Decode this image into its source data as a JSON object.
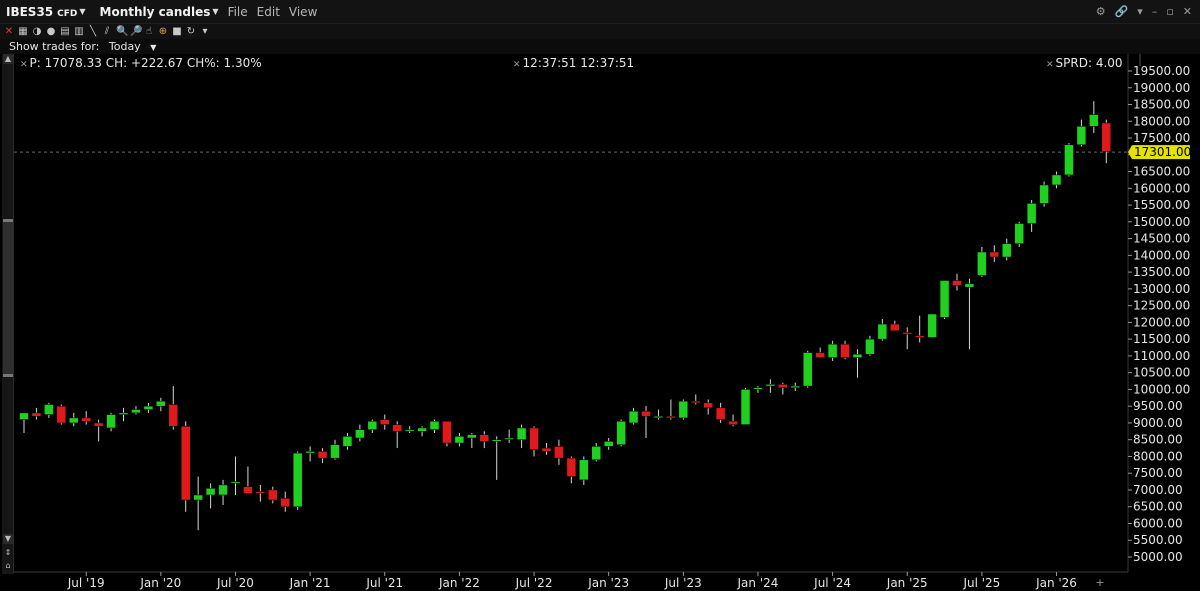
{
  "window": {
    "symbol": "IBES35",
    "symbol_type": "CFD",
    "period": "Monthly candles",
    "menus": [
      "File",
      "Edit",
      "View"
    ],
    "menu_keys": [
      "F",
      "E",
      "V"
    ],
    "show_trades_label": "Show trades for:",
    "show_trades_value": "Today",
    "icons": [
      "gear-icon",
      "link-icon",
      "minimize-icon",
      "restore-icon",
      "close-icon"
    ]
  },
  "info_bar": {
    "left": "P: 17078.33 CH: +222.67 CH%: 1.30%",
    "center": "12:37:51 12:37:51",
    "right": "SPRD: 4.00"
  },
  "colors": {
    "up": "#1fd01f",
    "down": "#e0191c",
    "wick": "#d8d8d8",
    "price_tag": "#e6e200",
    "background": "#000000"
  },
  "chart_data": {
    "type": "candlestick",
    "ylim": [
      4700,
      19900
    ],
    "y_ticks": [
      "5000.00",
      "5500.00",
      "6000.00",
      "6500.00",
      "7000.00",
      "7500.00",
      "8000.00",
      "8500.00",
      "9000.00",
      "9500.00",
      "10000.00",
      "10500.00",
      "11000.00",
      "11500.00",
      "12000.00",
      "12500.00",
      "13000.00",
      "13500.00",
      "14000.00",
      "14500.00",
      "15000.00",
      "15500.00",
      "16000.00",
      "16500.00",
      "17000.00",
      "17500.00",
      "18000.00",
      "18500.00",
      "19000.00",
      "19500.00"
    ],
    "x_ticks": [
      {
        "label": "Jul '19",
        "index": 5
      },
      {
        "label": "Jan '20",
        "index": 11
      },
      {
        "label": "Jul '20",
        "index": 17
      },
      {
        "label": "Jan '21",
        "index": 23
      },
      {
        "label": "Jul '21",
        "index": 29
      },
      {
        "label": "Jan '22",
        "index": 35
      },
      {
        "label": "Jul '22",
        "index": 41
      },
      {
        "label": "Jan '23",
        "index": 47
      },
      {
        "label": "Jul '23",
        "index": 53
      },
      {
        "label": "Jan '24",
        "index": 59
      },
      {
        "label": "Jul '24",
        "index": 65
      },
      {
        "label": "Jan '25",
        "index": 71
      },
      {
        "label": "Jul '25",
        "index": 77
      },
      {
        "label": "Jan '26",
        "index": 83
      }
    ],
    "last_price_label": "17301.00",
    "last_price": 17080,
    "candles": [
      {
        "o": 9100,
        "h": 9300,
        "l": 8700,
        "c": 9300
      },
      {
        "o": 9300,
        "h": 9450,
        "l": 9100,
        "c": 9200
      },
      {
        "o": 9250,
        "h": 9600,
        "l": 9150,
        "c": 9550
      },
      {
        "o": 9500,
        "h": 9550,
        "l": 8950,
        "c": 9000
      },
      {
        "o": 9000,
        "h": 9300,
        "l": 8900,
        "c": 9150
      },
      {
        "o": 9150,
        "h": 9350,
        "l": 8950,
        "c": 9050
      },
      {
        "o": 9000,
        "h": 9100,
        "l": 8450,
        "c": 8900
      },
      {
        "o": 8850,
        "h": 9300,
        "l": 8750,
        "c": 9250
      },
      {
        "o": 9250,
        "h": 9450,
        "l": 9050,
        "c": 9300
      },
      {
        "o": 9300,
        "h": 9500,
        "l": 9250,
        "c": 9400
      },
      {
        "o": 9400,
        "h": 9600,
        "l": 9300,
        "c": 9500
      },
      {
        "o": 9500,
        "h": 9750,
        "l": 9350,
        "c": 9650
      },
      {
        "o": 9550,
        "h": 10100,
        "l": 8800,
        "c": 8900
      },
      {
        "o": 8900,
        "h": 9050,
        "l": 6350,
        "c": 6700
      },
      {
        "o": 6700,
        "h": 7400,
        "l": 5800,
        "c": 6850
      },
      {
        "o": 6850,
        "h": 7200,
        "l": 6450,
        "c": 7050
      },
      {
        "o": 6850,
        "h": 7300,
        "l": 6550,
        "c": 7150
      },
      {
        "o": 7250,
        "h": 8000,
        "l": 6850,
        "c": 7250
      },
      {
        "o": 7100,
        "h": 7700,
        "l": 6900,
        "c": 6900
      },
      {
        "o": 6950,
        "h": 7150,
        "l": 6650,
        "c": 6900
      },
      {
        "o": 7000,
        "h": 7100,
        "l": 6600,
        "c": 6700
      },
      {
        "o": 6750,
        "h": 6950,
        "l": 6350,
        "c": 6500
      },
      {
        "o": 6500,
        "h": 8150,
        "l": 6400,
        "c": 8100
      },
      {
        "o": 8100,
        "h": 8300,
        "l": 7850,
        "c": 8150
      },
      {
        "o": 8150,
        "h": 8250,
        "l": 7800,
        "c": 7950
      },
      {
        "o": 7950,
        "h": 8500,
        "l": 7900,
        "c": 8350
      },
      {
        "o": 8300,
        "h": 8700,
        "l": 8200,
        "c": 8600
      },
      {
        "o": 8550,
        "h": 8950,
        "l": 8450,
        "c": 8800
      },
      {
        "o": 8800,
        "h": 9100,
        "l": 8700,
        "c": 9050
      },
      {
        "o": 9100,
        "h": 9250,
        "l": 8800,
        "c": 8950
      },
      {
        "o": 8950,
        "h": 9050,
        "l": 8250,
        "c": 8750
      },
      {
        "o": 8800,
        "h": 8900,
        "l": 8700,
        "c": 8800
      },
      {
        "o": 8750,
        "h": 8900,
        "l": 8600,
        "c": 8850
      },
      {
        "o": 8800,
        "h": 9100,
        "l": 8700,
        "c": 9050
      },
      {
        "o": 9050,
        "h": 9050,
        "l": 8300,
        "c": 8400
      },
      {
        "o": 8400,
        "h": 8700,
        "l": 8300,
        "c": 8600
      },
      {
        "o": 8550,
        "h": 8700,
        "l": 8250,
        "c": 8650
      },
      {
        "o": 8650,
        "h": 8750,
        "l": 8250,
        "c": 8450
      },
      {
        "o": 8450,
        "h": 8600,
        "l": 7300,
        "c": 8500
      },
      {
        "o": 8550,
        "h": 8800,
        "l": 8400,
        "c": 8550
      },
      {
        "o": 8500,
        "h": 8950,
        "l": 8250,
        "c": 8850
      },
      {
        "o": 8850,
        "h": 8900,
        "l": 8000,
        "c": 8200
      },
      {
        "o": 8250,
        "h": 8400,
        "l": 8050,
        "c": 8150
      },
      {
        "o": 8300,
        "h": 8500,
        "l": 7750,
        "c": 7950
      },
      {
        "o": 7950,
        "h": 8000,
        "l": 7200,
        "c": 7400
      },
      {
        "o": 7300,
        "h": 8000,
        "l": 7150,
        "c": 7900
      },
      {
        "o": 7900,
        "h": 8400,
        "l": 7850,
        "c": 8300
      },
      {
        "o": 8300,
        "h": 8550,
        "l": 8200,
        "c": 8450
      },
      {
        "o": 8350,
        "h": 9100,
        "l": 8300,
        "c": 9050
      },
      {
        "o": 9000,
        "h": 9450,
        "l": 8950,
        "c": 9350
      },
      {
        "o": 9350,
        "h": 9500,
        "l": 8550,
        "c": 9200
      },
      {
        "o": 9200,
        "h": 9400,
        "l": 9100,
        "c": 9200
      },
      {
        "o": 9200,
        "h": 9700,
        "l": 9100,
        "c": 9150
      },
      {
        "o": 9150,
        "h": 9700,
        "l": 9100,
        "c": 9650
      },
      {
        "o": 9650,
        "h": 9850,
        "l": 9550,
        "c": 9600
      },
      {
        "o": 9600,
        "h": 9700,
        "l": 9250,
        "c": 9450
      },
      {
        "o": 9450,
        "h": 9600,
        "l": 9000,
        "c": 9100
      },
      {
        "o": 9050,
        "h": 9250,
        "l": 8900,
        "c": 8950
      },
      {
        "o": 8950,
        "h": 10050,
        "l": 8950,
        "c": 10000
      },
      {
        "o": 10050,
        "h": 10100,
        "l": 9900,
        "c": 10050
      },
      {
        "o": 10100,
        "h": 10300,
        "l": 9900,
        "c": 10150
      },
      {
        "o": 10150,
        "h": 10200,
        "l": 9850,
        "c": 10050
      },
      {
        "o": 10050,
        "h": 10200,
        "l": 9950,
        "c": 10100
      },
      {
        "o": 10100,
        "h": 11150,
        "l": 10050,
        "c": 11100
      },
      {
        "o": 11100,
        "h": 11250,
        "l": 10950,
        "c": 10950
      },
      {
        "o": 10950,
        "h": 11450,
        "l": 10850,
        "c": 11350
      },
      {
        "o": 11350,
        "h": 11450,
        "l": 10900,
        "c": 10950
      },
      {
        "o": 10950,
        "h": 11200,
        "l": 10350,
        "c": 11050
      },
      {
        "o": 11050,
        "h": 11600,
        "l": 11000,
        "c": 11500
      },
      {
        "o": 11500,
        "h": 12100,
        "l": 11450,
        "c": 11950
      },
      {
        "o": 11950,
        "h": 12050,
        "l": 11750,
        "c": 11750
      },
      {
        "o": 11700,
        "h": 11850,
        "l": 11200,
        "c": 11650
      },
      {
        "o": 11600,
        "h": 12200,
        "l": 11400,
        "c": 11550
      },
      {
        "o": 11550,
        "h": 12250,
        "l": 11550,
        "c": 12250
      },
      {
        "o": 12150,
        "h": 13100,
        "l": 12100,
        "c": 13250
      },
      {
        "o": 13250,
        "h": 13450,
        "l": 12950,
        "c": 13100
      },
      {
        "o": 13050,
        "h": 13300,
        "l": 11200,
        "c": 13150
      },
      {
        "o": 13400,
        "h": 14250,
        "l": 13350,
        "c": 14100
      },
      {
        "o": 14100,
        "h": 14300,
        "l": 13800,
        "c": 13950
      },
      {
        "o": 13950,
        "h": 14500,
        "l": 13850,
        "c": 14350
      },
      {
        "o": 14350,
        "h": 15000,
        "l": 14250,
        "c": 14950
      },
      {
        "o": 14950,
        "h": 15650,
        "l": 14700,
        "c": 15550
      },
      {
        "o": 15550,
        "h": 16200,
        "l": 15450,
        "c": 16100
      },
      {
        "o": 16100,
        "h": 16500,
        "l": 16000,
        "c": 16400
      },
      {
        "o": 16400,
        "h": 17350,
        "l": 16350,
        "c": 17300
      },
      {
        "o": 17300,
        "h": 18050,
        "l": 17250,
        "c": 17850
      },
      {
        "o": 17850,
        "h": 18600,
        "l": 17650,
        "c": 18200
      },
      {
        "o": 17950,
        "h": 18050,
        "l": 16750,
        "c": 17100
      }
    ]
  }
}
